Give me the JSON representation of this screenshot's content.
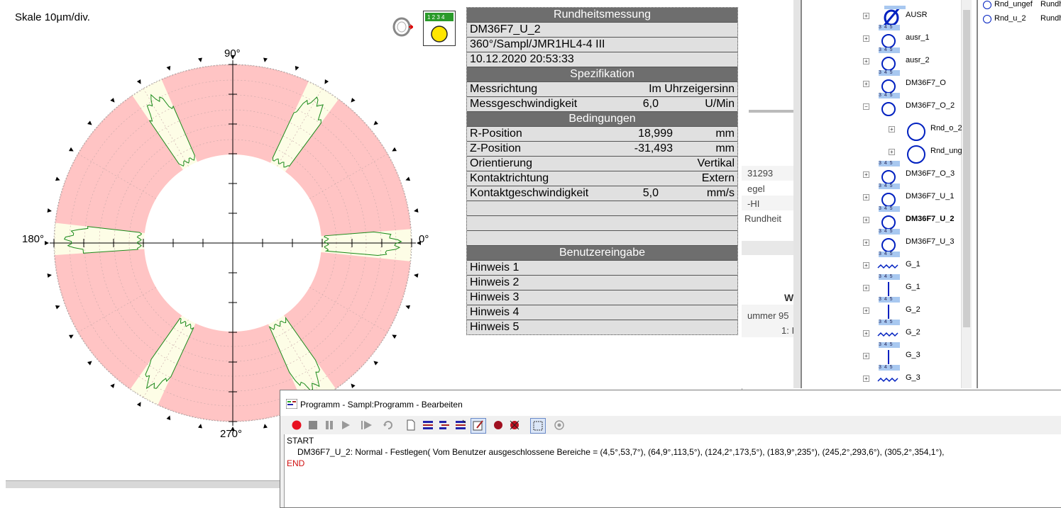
{
  "polar": {
    "scale_label": "Skale 10µm/div.",
    "label_90": "90°",
    "label_180": "180°",
    "label_0": "0°",
    "label_270": "270°"
  },
  "table": {
    "title": "Rundheitsmessung",
    "name": "DM36F7_U_2",
    "program": "360°/Sampl/JMR1HL4-4 III",
    "datetime": "10.12.2020 20:53:33",
    "sec_spec": "Spezifikation",
    "messrichtung_label": "Messrichtung",
    "messrichtung_value": "Im Uhrzeigersinn",
    "messgeschw_label": "Messgeschwindigkeit",
    "messgeschw_value": "6,0",
    "messgeschw_unit": "U/Min",
    "sec_cond": "Bedingungen",
    "rpos_label": "R-Position",
    "rpos_value": "18,999",
    "rpos_unit": "mm",
    "zpos_label": "Z-Position",
    "zpos_value": "-31,493",
    "zpos_unit": "mm",
    "orient_label": "Orientierung",
    "orient_value": "Vertikal",
    "kontakt_label": "Kontaktrichtung",
    "kontakt_value": "Extern",
    "kgeschw_label": "Kontaktgeschwindigkeit",
    "kgeschw_value": "5,0",
    "kgeschw_unit": "mm/s",
    "sec_user": "Benutzereingabe",
    "hinweis": [
      "Hinweis 1",
      "Hinweis 2",
      "Hinweis 3",
      "Hinweis 4",
      "Hinweis 5"
    ]
  },
  "midpanel": {
    "t1": "31293",
    "t2": "egel",
    "t3": "-HI",
    "t4": "Rundheit",
    "t5": "W",
    "t6": "ummer 95",
    "t7": "1: I"
  },
  "tree": {
    "items": [
      {
        "label": "AUSR",
        "icon": "ausr-icon"
      },
      {
        "label": "ausr_1",
        "icon": "circle-icon"
      },
      {
        "label": "ausr_2",
        "icon": "circle-icon"
      },
      {
        "label": "DM36F7_O",
        "icon": "circle-icon"
      },
      {
        "label": "DM36F7_O_2",
        "icon": "circle-icon"
      },
      {
        "label": "Rnd_o_2",
        "icon": "circle-icon"
      },
      {
        "label": "Rnd_ung",
        "icon": "circle-icon"
      },
      {
        "label": "DM36F7_O_3",
        "icon": "circle-icon"
      },
      {
        "label": "DM36F7_U_1",
        "icon": "circle-icon"
      },
      {
        "label": "DM36F7_U_2",
        "icon": "circle-icon"
      },
      {
        "label": "DM36F7_U_3",
        "icon": "circle-icon"
      },
      {
        "label": "G_1",
        "icon": "wave-icon"
      },
      {
        "label": "G_1",
        "icon": "line-icon"
      },
      {
        "label": "G_2",
        "icon": "line-icon"
      },
      {
        "label": "G_2",
        "icon": "wave-icon"
      },
      {
        "label": "G_3",
        "icon": "line-icon"
      },
      {
        "label": "G_3",
        "icon": "wave-icon"
      }
    ]
  },
  "rightpanel": {
    "r1a": "Rnd_ungef",
    "r1b": "Rundh",
    "r2a": "Rnd_u_2",
    "r2b": "Rundh"
  },
  "program": {
    "title": "Programm - Sampl:Programm - Bearbeiten",
    "line_start": "START",
    "line_cmd": "DM36F7_U_2: Normal - Festlegen( Vom Benutzer ausgeschlossene Bereiche = (4,5°,53,7°), (64,9°,113,5°), (124,2°,173,5°), (183,9°,235°), (245,2°,293,6°), (305,2°,354,1°),",
    "line_end": "END"
  },
  "colors": {
    "excluded_zone": "#ffc4c4",
    "measured_zone": "#fdfde6",
    "profile": "#1a8a1a",
    "header_gray": "#6e6e6e",
    "record_red": "#e81020",
    "end_red": "#d01010",
    "tree_blue": "#0020c0"
  }
}
